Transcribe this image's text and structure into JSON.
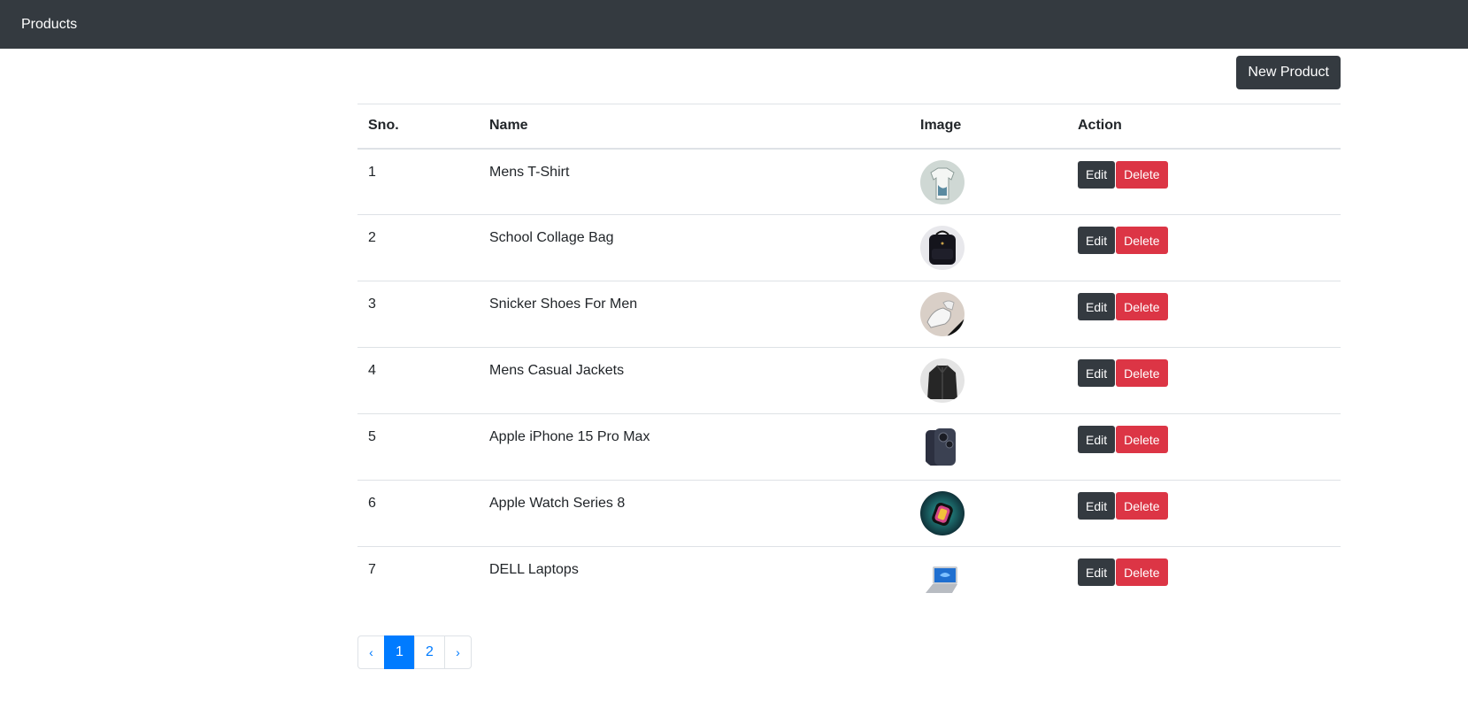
{
  "navbar": {
    "brand": "Products"
  },
  "toolbar": {
    "new_button": "New Product"
  },
  "table": {
    "headers": {
      "sno": "Sno.",
      "name": "Name",
      "image": "Image",
      "action": "Action"
    },
    "rows": [
      {
        "sno": "1",
        "name": "Mens T-Shirt",
        "image_icon": "tshirt-thumbnail",
        "edit": "Edit",
        "delete": "Delete"
      },
      {
        "sno": "2",
        "name": "School Collage Bag",
        "image_icon": "bag-thumbnail",
        "edit": "Edit",
        "delete": "Delete"
      },
      {
        "sno": "3",
        "name": "Snicker Shoes For Men",
        "image_icon": "shoes-thumbnail",
        "edit": "Edit",
        "delete": "Delete"
      },
      {
        "sno": "4",
        "name": "Mens Casual Jackets",
        "image_icon": "jacket-thumbnail",
        "edit": "Edit",
        "delete": "Delete"
      },
      {
        "sno": "5",
        "name": "Apple iPhone 15 Pro Max",
        "image_icon": "iphone-thumbnail",
        "edit": "Edit",
        "delete": "Delete"
      },
      {
        "sno": "6",
        "name": "Apple Watch Series 8",
        "image_icon": "watch-thumbnail",
        "edit": "Edit",
        "delete": "Delete"
      },
      {
        "sno": "7",
        "name": "DELL Laptops",
        "image_icon": "laptop-thumbnail",
        "edit": "Edit",
        "delete": "Delete"
      }
    ]
  },
  "pagination": {
    "prev": "‹",
    "pages": [
      "1",
      "2"
    ],
    "active_page": "1",
    "next": "›"
  },
  "colors": {
    "navbar": "#343a40",
    "primary": "#007bff",
    "danger": "#dc3545",
    "dark_button": "#343a40"
  }
}
